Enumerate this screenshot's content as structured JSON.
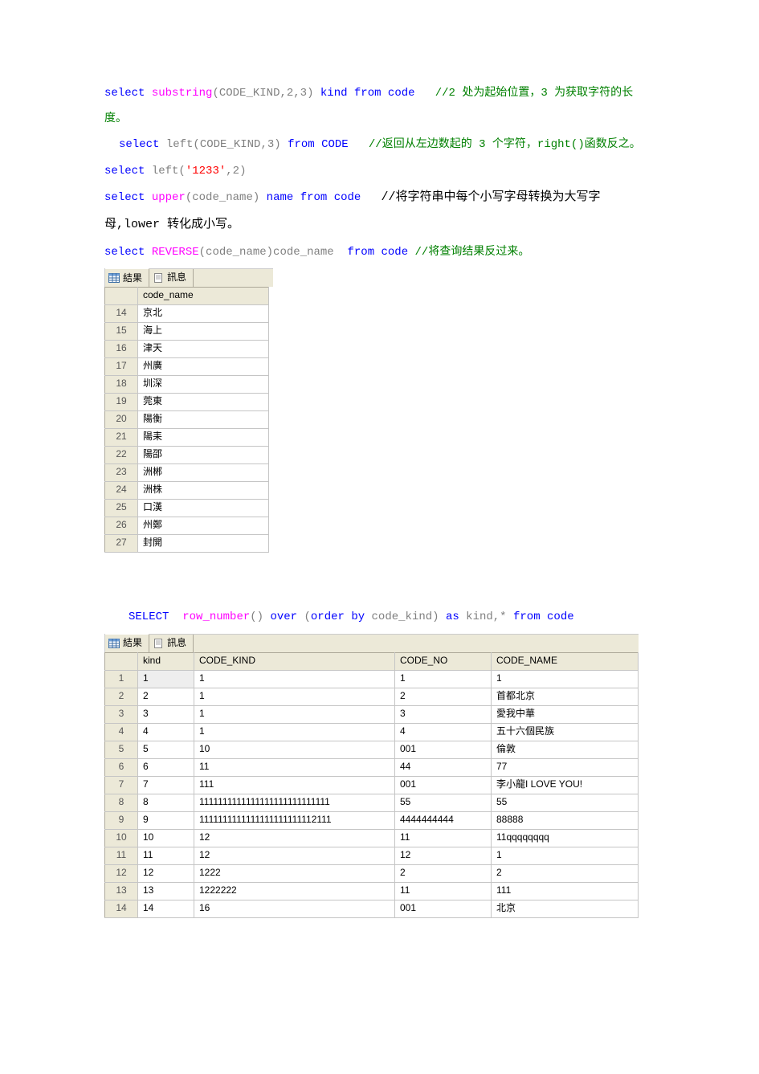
{
  "lines": {
    "l1a": "select",
    "l1b": "substring",
    "l1c": "(CODE_KIND,2,3)",
    "l1d": "kind",
    "l1e": "from",
    "l1f": "code",
    "l1g": "//2 处为起始位置，3 为获取字符的长度。",
    "l2a": "select",
    "l2b": "left(CODE_KIND,3)",
    "l2c": "from",
    "l2d": "CODE",
    "l2e": "//返回从左边数起的 3 个字符，right()函数反之。",
    "l3a": "select",
    "l3b": "left(",
    "l3c": "'1233'",
    "l3d": ",2)",
    "l4a": "select",
    "l4b": "upper",
    "l4c": "(code_name)",
    "l4d": "name",
    "l4e": "from",
    "l4f": "code",
    "l4g": "//将字符串中每个小写字母转换为大写字母,lower 转化成小写。",
    "l5a": "select",
    "l5b": "REVERSE",
    "l5c": "(code_name)code_name",
    "l5d": "from",
    "l5e": "code",
    "l5f": "//将查询结果反过来。",
    "l6a": "SELECT",
    "l6b": "row_number",
    "l6c": "()",
    "l6d": "over",
    "l6e": "(",
    "l6f": "order",
    "l6g": "by",
    "l6h": "code_kind)",
    "l6i": "as",
    "l6j": "kind,*",
    "l6k": "from",
    "l6l": "code"
  },
  "tabs": {
    "results": "結果",
    "messages": "訊息"
  },
  "table1": {
    "header": "code_name",
    "rows": [
      {
        "n": "14",
        "v": "京北"
      },
      {
        "n": "15",
        "v": "海上"
      },
      {
        "n": "16",
        "v": "津天"
      },
      {
        "n": "17",
        "v": "州廣"
      },
      {
        "n": "18",
        "v": "圳深"
      },
      {
        "n": "19",
        "v": "莞東"
      },
      {
        "n": "20",
        "v": "陽衡"
      },
      {
        "n": "21",
        "v": "陽耒"
      },
      {
        "n": "22",
        "v": "陽邵"
      },
      {
        "n": "23",
        "v": "洲郴"
      },
      {
        "n": "24",
        "v": "洲株"
      },
      {
        "n": "25",
        "v": "口漢"
      },
      {
        "n": "26",
        "v": "州鄭"
      },
      {
        "n": "27",
        "v": "封開"
      }
    ]
  },
  "table2": {
    "headers": [
      "kind",
      "CODE_KIND",
      "CODE_NO",
      "CODE_NAME"
    ],
    "rows": [
      {
        "n": "1",
        "c": [
          "1",
          "1",
          "1",
          "1"
        ]
      },
      {
        "n": "2",
        "c": [
          "2",
          "1",
          "2",
          "首都北京"
        ]
      },
      {
        "n": "3",
        "c": [
          "3",
          "1",
          "3",
          "愛我中華"
        ]
      },
      {
        "n": "4",
        "c": [
          "4",
          "1",
          "4",
          "五十六個民族"
        ]
      },
      {
        "n": "5",
        "c": [
          "5",
          "10",
          "001",
          "倫敦"
        ]
      },
      {
        "n": "6",
        "c": [
          "6",
          "11",
          "44",
          "77"
        ]
      },
      {
        "n": "7",
        "c": [
          "7",
          "111",
          "001",
          "李小龍I LOVE YOU!"
        ]
      },
      {
        "n": "8",
        "c": [
          "8",
          "1111111111111111111111111111",
          "55",
          "55"
        ]
      },
      {
        "n": "9",
        "c": [
          "9",
          "1111111111111111111111112111",
          "4444444444",
          "88888"
        ]
      },
      {
        "n": "10",
        "c": [
          "10",
          "12",
          "11",
          "11qqqqqqqq"
        ]
      },
      {
        "n": "11",
        "c": [
          "11",
          "12",
          "12",
          "1"
        ]
      },
      {
        "n": "12",
        "c": [
          "12",
          "1222",
          "2",
          "2"
        ]
      },
      {
        "n": "13",
        "c": [
          "13",
          "1222222",
          "11",
          "111"
        ]
      },
      {
        "n": "14",
        "c": [
          "14",
          "16",
          "001",
          "北京"
        ]
      }
    ]
  }
}
